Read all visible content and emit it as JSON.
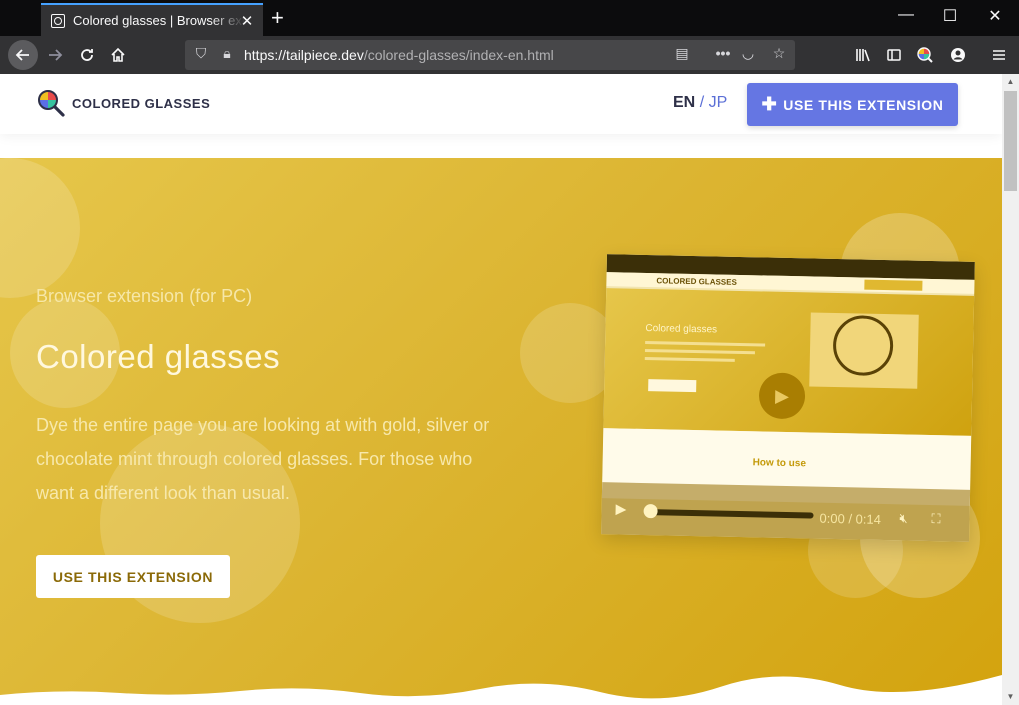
{
  "browser": {
    "tab_title": "Colored glasses | Browser extension",
    "url_host": "https://tailpiece.dev",
    "url_path": "/colored-glasses/index-en.html",
    "colors": {
      "chrome_dark": "#0c0c0d",
      "toolbar": "#323234",
      "urlbar": "#474749",
      "tab_accent": "#45a1ff"
    }
  },
  "site": {
    "logo_text": "COLORED GLASSES",
    "lang_en": "EN",
    "lang_sep": "/",
    "lang_jp": "JP",
    "top_cta": "USE THIS EXTENSION",
    "colors": {
      "primary": "#6576e3",
      "logo_text": "#2e3048"
    }
  },
  "hero": {
    "subtitle": "Browser extension (for PC)",
    "title": "Colored glasses",
    "description": "Dye the entire page you are looking at with gold, silver or chocolate mint through colored glasses. For those who want a different look than usual.",
    "cta": "USE THIS EXTENSION",
    "colors": {
      "gold_light": "#e6c64a",
      "gold_dark": "#d3a30e",
      "cta_text": "#8b6a08"
    }
  },
  "video": {
    "time_current": "0:00",
    "time_total": "0:14",
    "inner_logo": "COLORED GLASSES",
    "inner_title": "Colored glasses",
    "inner_section": "How to use"
  }
}
